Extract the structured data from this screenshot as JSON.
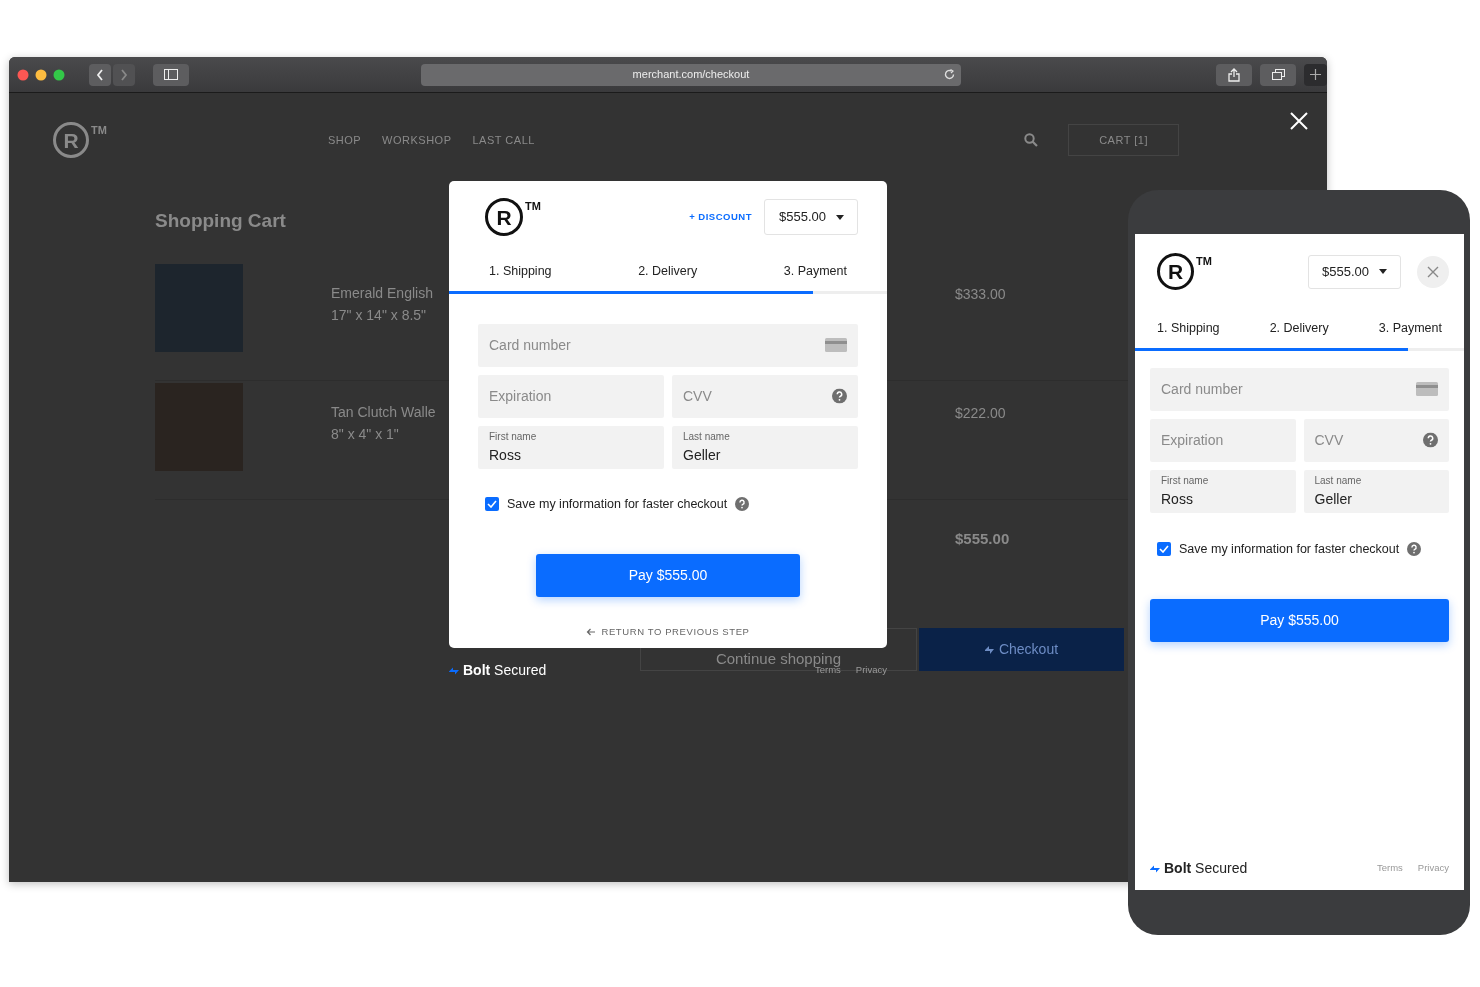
{
  "browser": {
    "url": "merchant.com/checkout"
  },
  "store": {
    "logo": {
      "mark": "R",
      "tm": "TM"
    },
    "nav": [
      "SHOP",
      "WORKSHOP",
      "LAST CALL"
    ],
    "cart_button": "CART [1]",
    "cart_title": "Shopping Cart",
    "items": [
      {
        "name": "Emerald English",
        "size": "17\" x 14\" x 8.5\"",
        "price": "$333.00"
      },
      {
        "name": "Tan Clutch Walle",
        "size": "8\" x 4\" x 1\"",
        "price": "$222.00"
      }
    ],
    "total": "$555.00",
    "continue_button": "Continue shopping",
    "checkout_button": "Checkout"
  },
  "desktop_checkout": {
    "logo": {
      "mark": "R",
      "tm": "TM"
    },
    "discount_link": "+ DISCOUNT",
    "amount": "$555.00",
    "steps": [
      "1. Shipping",
      "2. Delivery",
      "3. Payment"
    ],
    "progress": {
      "level": 0.83
    },
    "card_number": {
      "placeholder": "Card number"
    },
    "expiration": {
      "placeholder": "Expiration"
    },
    "cvv": {
      "placeholder": "CVV"
    },
    "first_name": {
      "label": "First name",
      "value": "Ross"
    },
    "last_name": {
      "label": "Last name",
      "value": "Geller"
    },
    "save_info": {
      "label": "Save my information for faster checkout",
      "checked": true
    },
    "pay_button": "Pay $555.00",
    "return_link": "RETURN TO PREVIOUS STEP",
    "footer": {
      "brand": "**Bolt** Secured",
      "links": [
        "Terms",
        "Privacy"
      ]
    }
  },
  "mobile_checkout": {
    "logo": {
      "mark": "R",
      "tm": "TM"
    },
    "amount": "$555.00",
    "steps": [
      "1. Shipping",
      "2. Delivery",
      "3. Payment"
    ],
    "progress": {
      "level": 0.83
    },
    "card_number": {
      "placeholder": "Card number"
    },
    "expiration": {
      "placeholder": "Expiration"
    },
    "cvv": {
      "placeholder": "CVV"
    },
    "first_name": {
      "label": "First name",
      "value": "Ross"
    },
    "last_name": {
      "label": "Last name",
      "value": "Geller"
    },
    "save_info": {
      "label": "Save my information for faster checkout",
      "checked": true
    },
    "pay_button": "Pay $555.00",
    "footer": {
      "brand": "**Bolt** Secured",
      "links": [
        "Terms",
        "Privacy"
      ]
    }
  }
}
